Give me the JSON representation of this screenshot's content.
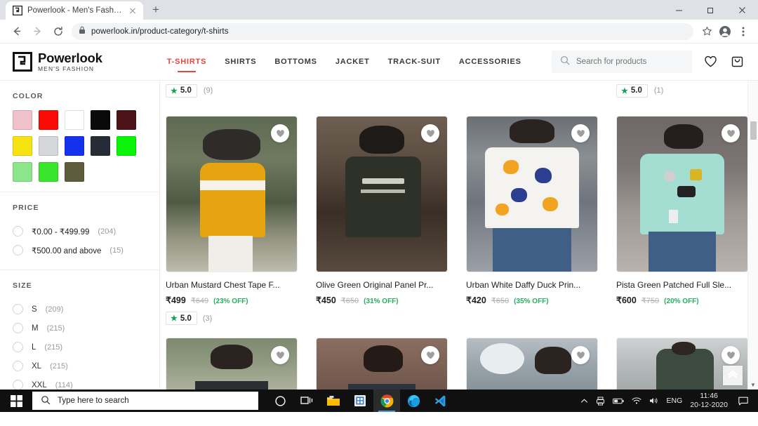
{
  "browser": {
    "tab": {
      "title": "Powerlook - Men's Fashion",
      "favicon": "powerlook-logo-icon",
      "close": "×"
    },
    "new_tab_label": "+",
    "window_controls": {
      "minimize": "—",
      "maximize": "❐",
      "close": "✕"
    },
    "toolbar": {
      "back": "←",
      "forward": "→",
      "reload": "⟳",
      "lock": "lock-icon",
      "url": "powerlook.in/product-category/t-shirts",
      "bookmark": "star-icon",
      "profile": "profile-icon",
      "menu": "kebab-menu-icon"
    }
  },
  "site": {
    "logo": {
      "name": "Powerlook",
      "tagline": "MEN'S FASHION"
    },
    "nav": [
      {
        "label": "T-SHIRTS",
        "active": true
      },
      {
        "label": "SHIRTS",
        "active": false
      },
      {
        "label": "BOTTOMS",
        "active": false
      },
      {
        "label": "JACKET",
        "active": false
      },
      {
        "label": "TRACK-SUIT",
        "active": false
      },
      {
        "label": "ACCESSORIES",
        "active": false
      }
    ],
    "search": {
      "placeholder": "Search for products",
      "value": ""
    },
    "wishlist_icon": "heart-icon",
    "cart_icon": "shopping-bag-icon"
  },
  "filters": {
    "color": {
      "title": "COLOR",
      "swatches": [
        "#f2c2cb",
        "#fb0b05",
        "#ffffff",
        "#0a0a0a",
        "#4c1418",
        "#f8e312",
        "#d5d7db",
        "#1432ed",
        "#262b38",
        "#09f409",
        "#8be58b",
        "#3ae62c",
        "#5f5c3b"
      ]
    },
    "price": {
      "title": "PRICE",
      "options": [
        {
          "label": "₹0.00 - ₹499.99",
          "count": "(204)"
        },
        {
          "label": "₹500.00 and above",
          "count": "(15)"
        }
      ]
    },
    "size": {
      "title": "SIZE",
      "options": [
        {
          "label": "S",
          "count": "(209)"
        },
        {
          "label": "M",
          "count": "(215)"
        },
        {
          "label": "L",
          "count": "(215)"
        },
        {
          "label": "XL",
          "count": "(215)"
        },
        {
          "label": "XXL",
          "count": "(114)"
        }
      ]
    }
  },
  "grid": {
    "top_ratings": [
      {
        "value": "5.0",
        "count": "(9)",
        "col": 1
      },
      {
        "value": "5.0",
        "count": "(1)",
        "col": 4
      }
    ],
    "products": [
      {
        "title": "Urban Mustard Chest Tape F...",
        "price": "₹499",
        "mrp": "₹649",
        "discount": "(23% OFF)",
        "rating": "5.0",
        "rating_count": "(3)",
        "wishlist_icon": "heart-icon"
      },
      {
        "title": "Olive Green Original Panel Pr...",
        "price": "₹450",
        "mrp": "₹650",
        "discount": "(31% OFF)",
        "rating": "",
        "rating_count": "",
        "wishlist_icon": "heart-icon"
      },
      {
        "title": "Urban White Daffy Duck Prin...",
        "price": "₹420",
        "mrp": "₹650",
        "discount": "(35% OFF)",
        "rating": "",
        "rating_count": "",
        "wishlist_icon": "heart-icon"
      },
      {
        "title": "Pista Green Patched Full Sle...",
        "price": "₹600",
        "mrp": "₹750",
        "discount": "(20% OFF)",
        "rating": "",
        "rating_count": "",
        "wishlist_icon": "heart-icon"
      }
    ],
    "next_row_wishlist_icon": "heart-icon",
    "scroll_top_icon": "double-chevron-up-icon"
  },
  "taskbar": {
    "start_icon": "windows-start-icon",
    "search_placeholder": "Type here to search",
    "search_icon": "search-icon",
    "apps": [
      {
        "name": "cortana-icon",
        "active": false
      },
      {
        "name": "task-view-icon",
        "active": false
      },
      {
        "name": "file-explorer-icon",
        "active": false
      },
      {
        "name": "microsoft-store-icon",
        "active": false
      },
      {
        "name": "google-chrome-icon",
        "active": true
      },
      {
        "name": "microsoft-edge-icon",
        "active": false
      },
      {
        "name": "visual-studio-code-icon",
        "active": false
      }
    ],
    "tray": {
      "overflow": "^",
      "icons": [
        "printer-icon",
        "battery-icon",
        "wifi-icon",
        "volume-icon"
      ],
      "language": "ENG",
      "time": "11:46",
      "date": "20-12-2020",
      "notifications": "action-center-icon"
    }
  }
}
